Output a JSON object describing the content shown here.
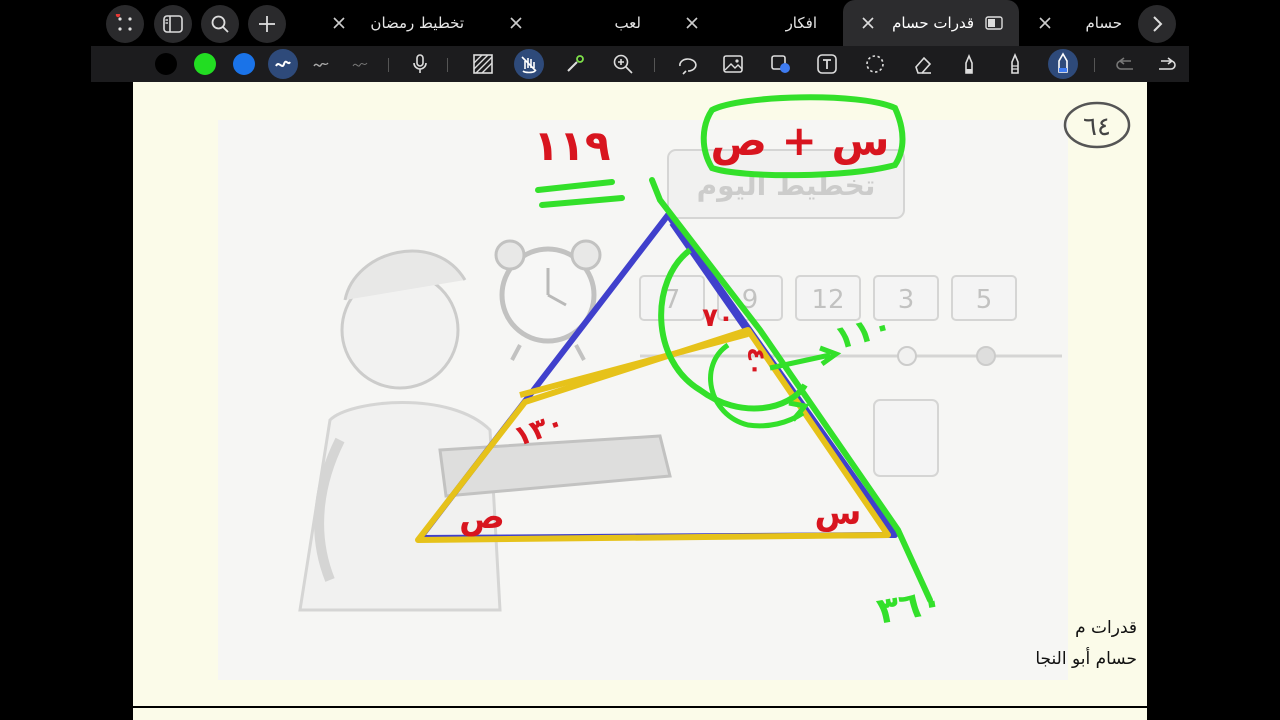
{
  "tabs": [
    {
      "label": "حسام",
      "active": false
    },
    {
      "label": "قدرات حسام",
      "active": true
    },
    {
      "label": "افكار",
      "active": false
    },
    {
      "label": "لعب",
      "active": false
    },
    {
      "label": "تخطيط رمضان",
      "active": false
    }
  ],
  "window_controls": [
    "grid-dots-icon",
    "sidebar-icon",
    "search-icon",
    "plus-icon"
  ],
  "toolbar": {
    "colors": [
      "#000000",
      "#22dd22",
      "#1a73e8"
    ],
    "tools": [
      "pen-stroke-thick",
      "pen-stroke-medium",
      "pen-stroke-thin",
      "microphone-icon",
      "pattern-icon",
      "hand-icon",
      "laser-icon",
      "zoom-icon",
      "lasso-icon",
      "image-icon",
      "shape-icon",
      "text-icon",
      "select-icon",
      "eraser-icon",
      "highlighter-icon",
      "pencil-icon",
      "pen-icon",
      "undo-icon",
      "redo-icon"
    ]
  },
  "canvas": {
    "page_number": "٦٤",
    "printed_title": "تخطيط اليوم",
    "timeline_numbers": [
      "7",
      "9",
      "12",
      "3",
      "5"
    ],
    "annotations": {
      "top_left_number": "١١٩",
      "top_box_expression": "س + ص",
      "angle_top": "٧٠",
      "angle_inner": "٤٠",
      "angle_right_ext": "١١٠",
      "angle_left": "١٣٠",
      "label_bottom_left": "ص",
      "label_bottom_right": "س",
      "bottom_total": "٣٦٠"
    },
    "annotation_colors": {
      "red": "#d8151f",
      "green": "#33e02a",
      "blue": "#4040cc",
      "yellow": "#e6c21a"
    }
  },
  "footer": {
    "line1": "قدرات م",
    "line2": "حسام أبو النجا"
  }
}
